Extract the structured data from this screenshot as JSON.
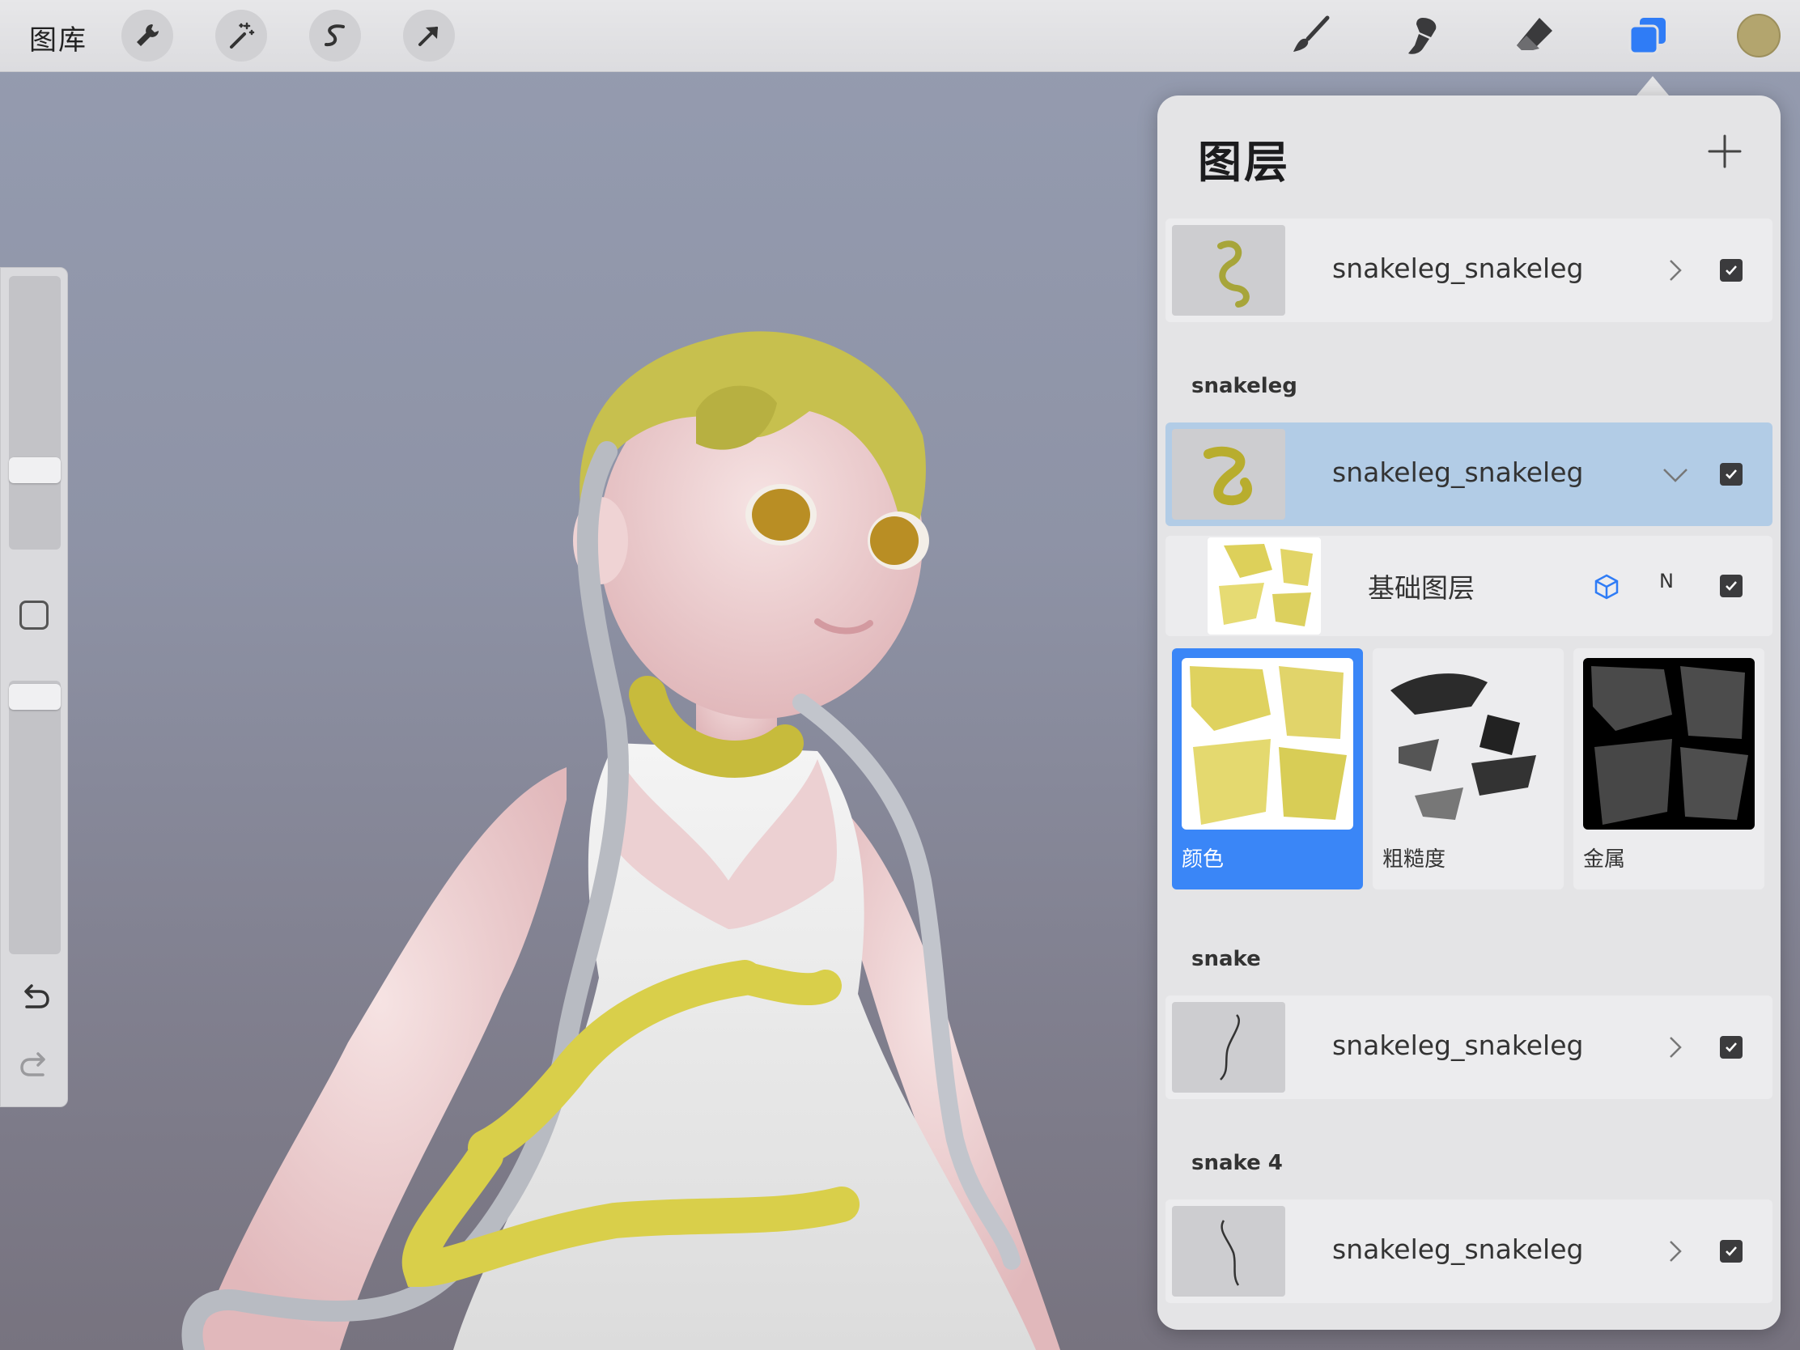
{
  "topbar": {
    "gallery_label": "图库",
    "left_tools": [
      "wrench-icon",
      "magic-wand-icon",
      "selection-s-icon",
      "transform-arrow-icon"
    ],
    "right_tools": [
      "brush-icon",
      "smudge-icon",
      "eraser-icon",
      "layers-icon"
    ],
    "active_tool": "layers-icon",
    "layers_icon_color": "#2f7cf6",
    "current_color": "#b3a56e"
  },
  "sidebar": {
    "brush_size": 0.27,
    "opacity": 0.04,
    "undo_icon": "undo-icon",
    "redo_icon": "redo-icon"
  },
  "layers_panel": {
    "title": "图层",
    "add_icon": "plus-icon",
    "top_layer": {
      "name": "snakeleg_snakeleg",
      "visible": true
    },
    "groups": [
      {
        "title": "snakeleg",
        "layer": {
          "name": "snakeleg_snakeleg",
          "visible": true,
          "selected": true,
          "expanded": true
        },
        "sublayer": {
          "name": "基础图层",
          "flag": "N",
          "visible": true
        },
        "materials": [
          {
            "label": "颜色",
            "selected": true
          },
          {
            "label": "粗糙度",
            "selected": false
          },
          {
            "label": "金属",
            "selected": false
          }
        ]
      },
      {
        "title": "snake",
        "layer": {
          "name": "snakeleg_snakeleg",
          "visible": true
        }
      },
      {
        "title": "snake 4",
        "layer": {
          "name": "snakeleg_snakeleg",
          "visible": true
        }
      }
    ]
  },
  "colors": {
    "accent": "#3a86f7",
    "selected_row": "#b2cce6",
    "panel_bg": "#e4e4e6"
  }
}
